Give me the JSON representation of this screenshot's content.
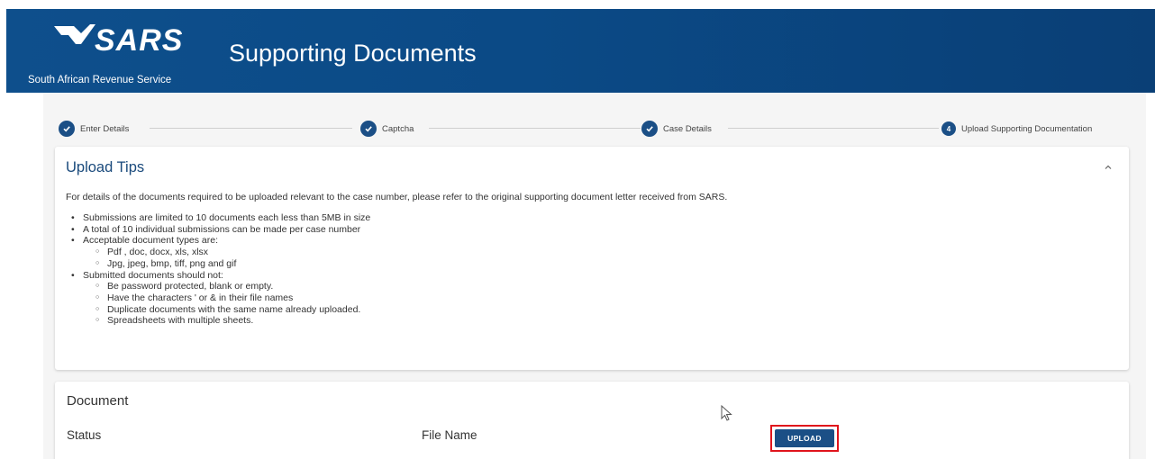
{
  "header": {
    "logo_text": "SARS",
    "org_name": "South African Revenue Service",
    "title": "Supporting Documents",
    "color_start": "#0e4f8c",
    "color_end": "#0a3f76"
  },
  "stepper": {
    "steps": [
      {
        "label": "Enter Details",
        "state": "complete",
        "icon": "check-icon"
      },
      {
        "label": "Captcha",
        "state": "complete",
        "icon": "check-icon"
      },
      {
        "label": "Case Details",
        "state": "complete",
        "icon": "check-icon"
      },
      {
        "label": "Upload Supporting Documentation",
        "state": "current",
        "number": "4"
      }
    ]
  },
  "tips": {
    "title": "Upload Tips",
    "intro": "For details of the documents required to be uploaded relevant to the case number, please refer to the original supporting document letter received from SARS.",
    "items": [
      "Submissions are limited to 10 documents each less than 5MB in size",
      "A total of 10 individual submissions can be made per case number",
      "Acceptable document types are:",
      "Pdf , doc, docx, xls, xlsx",
      "Jpg, jpeg, bmp, tiff, png and gif",
      "Submitted documents should not:",
      "Be password protected, blank or empty.",
      "Have the characters ' or & in their file names",
      "Duplicate documents with the same name already uploaded.",
      "Spreadsheets with multiple sheets."
    ]
  },
  "document": {
    "title": "Document",
    "col_status": "Status",
    "col_filename": "File Name",
    "upload_label": "UPLOAD"
  },
  "colors": {
    "accent": "#1b4f86",
    "highlight": "#e0141c"
  }
}
